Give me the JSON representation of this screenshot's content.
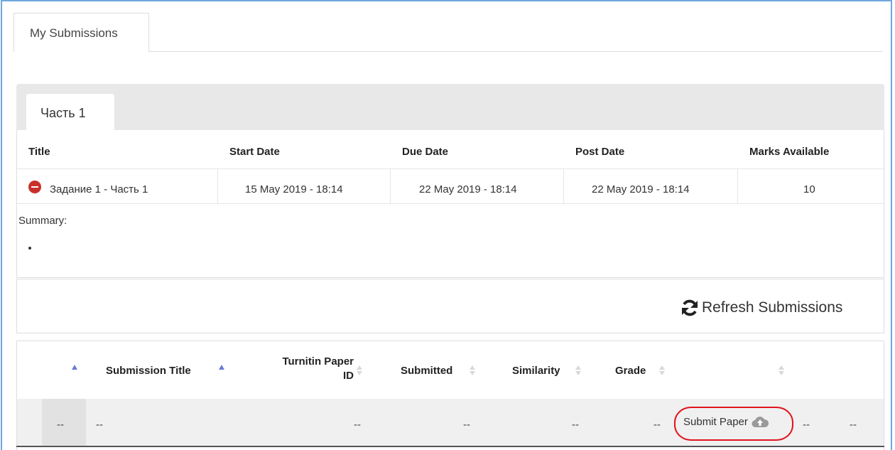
{
  "tabs": {
    "my_submissions": "My Submissions"
  },
  "part_tab": {
    "label": "Часть 1"
  },
  "assignment_table": {
    "headers": [
      "Title",
      "Start Date",
      "Due Date",
      "Post Date",
      "Marks Available"
    ],
    "row": {
      "title": "Задание 1 - Часть 1",
      "start_date": "15 May 2019 - 18:14",
      "due_date": "22 May 2019 - 18:14",
      "post_date": "22 May 2019 - 18:14",
      "marks": "10",
      "status_icon": "minus-circle-icon"
    },
    "summary_label": "Summary:"
  },
  "refresh": {
    "label": "Refresh Submissions",
    "icon": "refresh-icon"
  },
  "submissions_table": {
    "headers": {
      "title": "Submission Title",
      "paper_id_line1": "Turnitin Paper",
      "paper_id_line2": "ID",
      "submitted": "Submitted",
      "similarity": "Similarity",
      "grade": "Grade"
    },
    "row": {
      "c0": "--",
      "c1": "--",
      "c2": "--",
      "c3": "--",
      "c4": "--",
      "c5": "--",
      "submit_label": "Submit Paper",
      "c6": "--",
      "c7": "--"
    }
  },
  "colors": {
    "annotation_circle": "#e0141e",
    "active_sort": "#6a7bd6",
    "status_red": "#c9302c"
  }
}
